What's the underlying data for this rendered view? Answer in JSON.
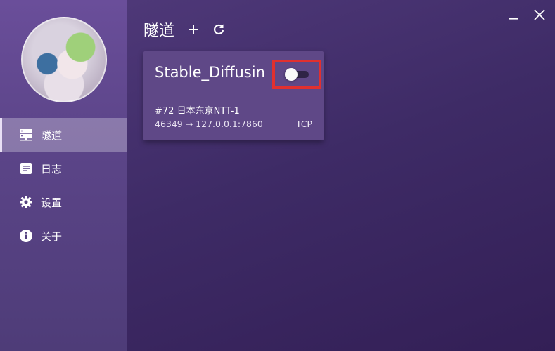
{
  "sidebar": {
    "items": [
      {
        "label": "隧道",
        "icon": "server-icon",
        "active": true
      },
      {
        "label": "日志",
        "icon": "log-icon",
        "active": false
      },
      {
        "label": "设置",
        "icon": "gear-icon",
        "active": false
      },
      {
        "label": "关于",
        "icon": "info-icon",
        "active": false
      }
    ]
  },
  "header": {
    "title": "隧道",
    "add_icon": "plus-icon",
    "refresh_icon": "refresh-icon"
  },
  "window": {
    "minimize_icon": "minimize-icon",
    "close_icon": "close-icon"
  },
  "tunnels": [
    {
      "name": "Stable_Diffusin",
      "enabled": false,
      "node": "#72 日本东京NTT-1",
      "route": "46349 → 127.0.0.1:7860",
      "protocol": "TCP"
    }
  ],
  "colors": {
    "highlight_box": "#e1302f",
    "card_bg": "#5f4887"
  }
}
